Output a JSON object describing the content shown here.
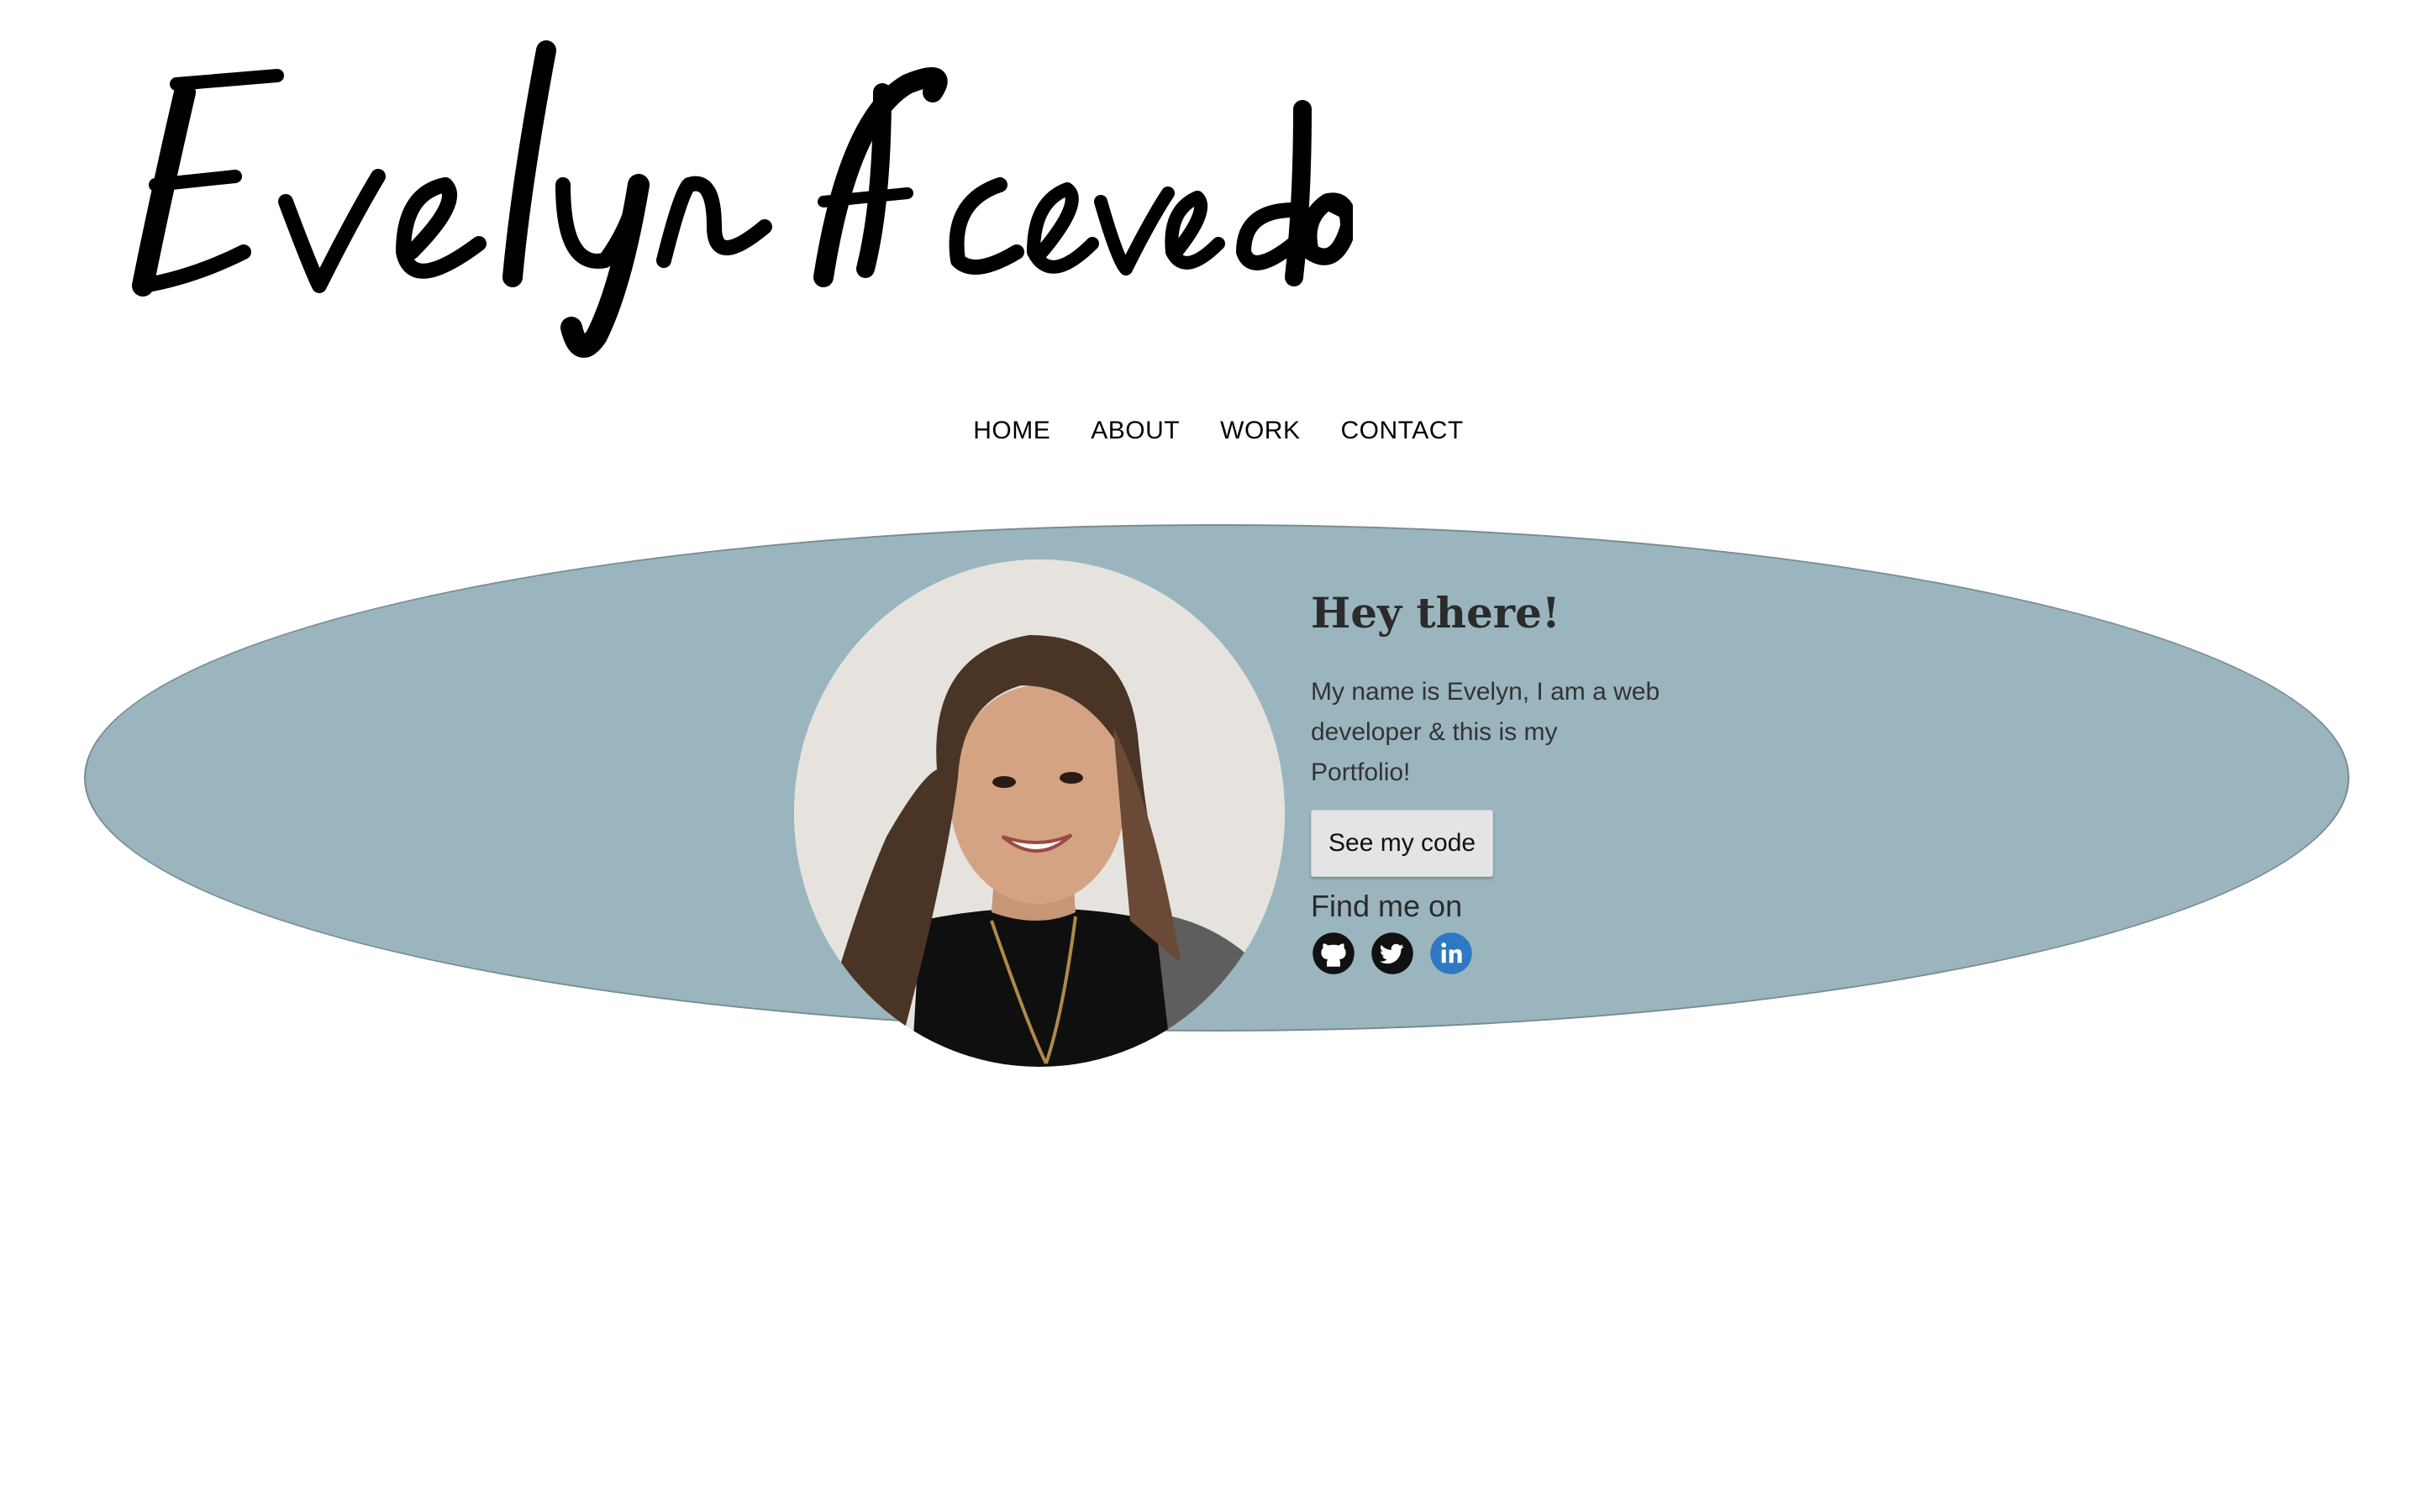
{
  "logo": {
    "text": "Evelyn Acevedo"
  },
  "nav": {
    "items": [
      "HOME",
      "ABOUT",
      "WORK",
      "CONTACT"
    ]
  },
  "hero": {
    "background_color": "#9ab5be",
    "portrait_alt": "portrait-photo",
    "heading": "Hey there!",
    "description": "My name is Evelyn, I am a web developer & this is my Portfolio!",
    "button_label": "See my code",
    "find_label": "Find me on",
    "socials": [
      {
        "icon": "github-icon",
        "color": "#111111"
      },
      {
        "icon": "twitter-icon",
        "color": "#111111"
      },
      {
        "icon": "linkedin-icon",
        "color": "#2f79c2"
      }
    ]
  }
}
